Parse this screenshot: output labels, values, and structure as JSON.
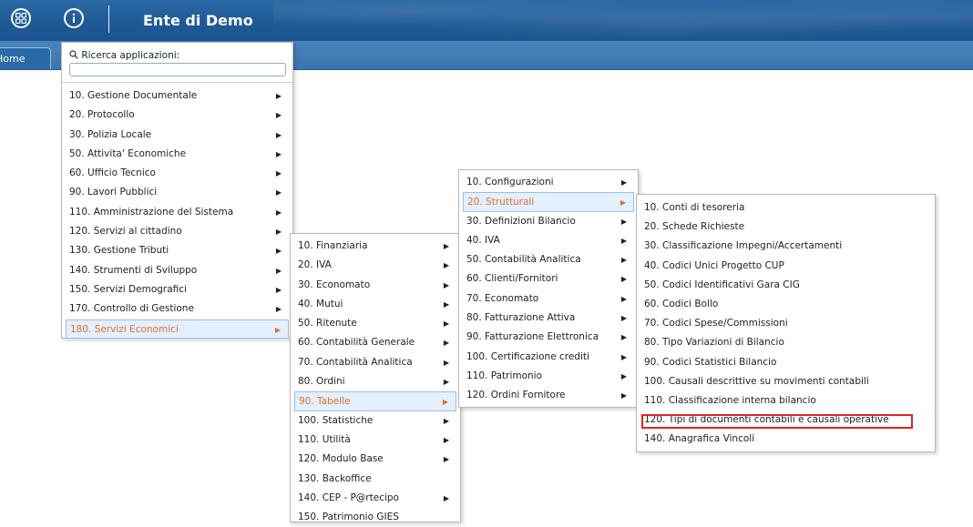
{
  "header": {
    "title": "Ente di Demo",
    "apps_icon": "apps-grid-icon",
    "info_icon": "info-icon"
  },
  "tabs": [
    {
      "label": "Home"
    }
  ],
  "launcher": {
    "search_label": "Ricerca applicazioni:",
    "search_value": "",
    "search_icon": "search-icon",
    "items": [
      {
        "label": "10. Gestione Documentale",
        "has_sub": true
      },
      {
        "label": "20. Protocollo",
        "has_sub": true
      },
      {
        "label": "30. Polizia Locale",
        "has_sub": true
      },
      {
        "label": "50. Attivita' Economiche",
        "has_sub": true
      },
      {
        "label": "60. Ufficio Tecnico",
        "has_sub": true
      },
      {
        "label": "90. Lavori Pubblici",
        "has_sub": true
      },
      {
        "label": "110. Amministrazione del Sistema",
        "has_sub": true
      },
      {
        "label": "120. Servizi al cittadino",
        "has_sub": true
      },
      {
        "label": "130. Gestione Tributi",
        "has_sub": true
      },
      {
        "label": "140. Strumenti di Sviluppo",
        "has_sub": true
      },
      {
        "label": "150. Servizi Demografici",
        "has_sub": true
      },
      {
        "label": "170. Controllo di Gestione",
        "has_sub": true
      },
      {
        "label": "180. Servizi Economici",
        "has_sub": true,
        "selected": true
      }
    ]
  },
  "submenu_economici": {
    "items": [
      {
        "label": "10. Finanziaria",
        "has_sub": true
      },
      {
        "label": "20. IVA",
        "has_sub": true
      },
      {
        "label": "30. Economato",
        "has_sub": true
      },
      {
        "label": "40. Mutui",
        "has_sub": true
      },
      {
        "label": "50. Ritenute",
        "has_sub": true
      },
      {
        "label": "60. Contabilità Generale",
        "has_sub": true
      },
      {
        "label": "70. Contabilità Analitica",
        "has_sub": true
      },
      {
        "label": "80. Ordini",
        "has_sub": true
      },
      {
        "label": "90. Tabelle",
        "has_sub": true,
        "selected": true
      },
      {
        "label": "100. Statistiche",
        "has_sub": true
      },
      {
        "label": "110. Utilità",
        "has_sub": true
      },
      {
        "label": "120. Modulo Base",
        "has_sub": true
      },
      {
        "label": "130. Backoffice",
        "has_sub": false
      },
      {
        "label": "140. CEP - P@rtecipo",
        "has_sub": true
      },
      {
        "label": "150. Patrimonio GIES",
        "has_sub": false
      }
    ]
  },
  "submenu_tabelle": {
    "items": [
      {
        "label": "10. Configurazioni",
        "has_sub": true
      },
      {
        "label": "20. Strutturali",
        "has_sub": true,
        "selected": true
      },
      {
        "label": "30. Definizioni Bilancio",
        "has_sub": true
      },
      {
        "label": "40. IVA",
        "has_sub": true
      },
      {
        "label": "50. Contabilità Analitica",
        "has_sub": true
      },
      {
        "label": "60. Clienti/Fornitori",
        "has_sub": true
      },
      {
        "label": "70. Economato",
        "has_sub": true
      },
      {
        "label": "80. Fatturazione Attiva",
        "has_sub": true
      },
      {
        "label": "90. Fatturazione Elettronica",
        "has_sub": true
      },
      {
        "label": "100. Certificazione crediti",
        "has_sub": true
      },
      {
        "label": "110. Patrimonio",
        "has_sub": true
      },
      {
        "label": "120. Ordini Fornitore",
        "has_sub": true
      }
    ]
  },
  "submenu_strutturali": {
    "items": [
      {
        "label": "10. Conti di tesoreria"
      },
      {
        "label": "20. Schede Richieste"
      },
      {
        "label": "30. Classificazione Impegni/Accertamenti"
      },
      {
        "label": "40. Codici Unici Progetto CUP"
      },
      {
        "label": "50. Codici Identificativi Gara CIG"
      },
      {
        "label": "60. Codici Bollo"
      },
      {
        "label": "70. Codici Spese/Commissioni"
      },
      {
        "label": "80. Tipo Variazioni di Bilancio"
      },
      {
        "label": "90. Codici Statistici Bilancio"
      },
      {
        "label": "100. Causali descrittive su movimenti contabili"
      },
      {
        "label": "110. Classificazione interna bilancio"
      },
      {
        "label": "120. Tipi di documenti contabili e causali operative",
        "highlighted": true
      },
      {
        "label": "140. Anagrafica Vincoli"
      }
    ]
  },
  "colors": {
    "header_bg": "#1f5a96",
    "selected_text": "#e0702c",
    "selected_bg": "#e4efff",
    "highlight_border": "#e52222"
  }
}
